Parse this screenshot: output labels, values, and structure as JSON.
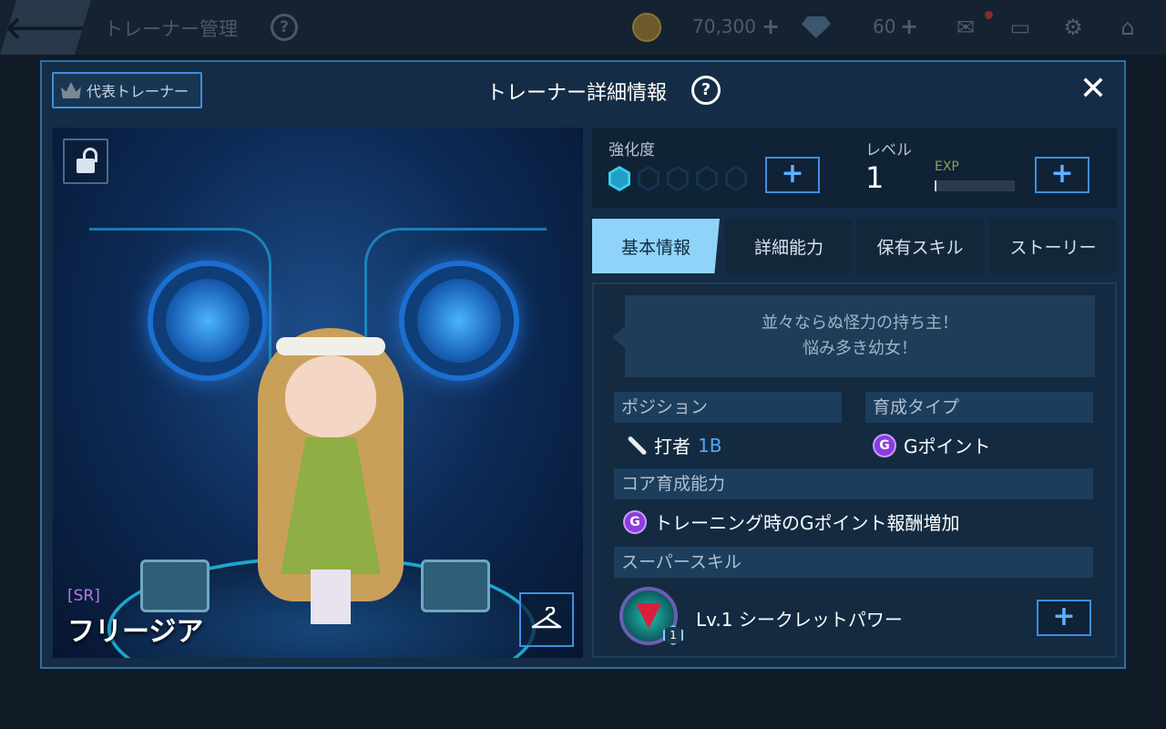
{
  "topbar": {
    "title": "トレーナー管理",
    "help_label": "?",
    "coins": "70,300",
    "gems": "60",
    "plus_label": "+"
  },
  "modal": {
    "representative_button": "代表トレーナー",
    "title": "トレーナー詳細情報",
    "help_label": "?",
    "close_label": "✕"
  },
  "character": {
    "rarity": "[SR]",
    "name": "フリージア"
  },
  "stats": {
    "enhancement_label": "強化度",
    "enhancement_filled": 1,
    "enhancement_total": 5,
    "level_label": "レベル",
    "level_value": "1",
    "exp_label": "EXP",
    "exp_fraction": 0.02,
    "plus_label": "+"
  },
  "tabs": [
    {
      "label": "基本情報",
      "active": true
    },
    {
      "label": "詳細能力",
      "active": false
    },
    {
      "label": "保有スキル",
      "active": false
    },
    {
      "label": "ストーリー",
      "active": false
    }
  ],
  "info": {
    "description_line1": "並々ならぬ怪力の持ち主！",
    "description_line2": "悩み多き幼女！",
    "position_header": "ポジション",
    "position_value": "打者",
    "position_detail": "1B",
    "growth_header": "育成タイプ",
    "growth_icon": "G",
    "growth_value": "Gポイント",
    "core_header": "コア育成能力",
    "core_icon": "G",
    "core_value": "トレーニング時のGポイント報酬増加",
    "super_skill_header": "スーパースキル",
    "skill_level_badge": "1",
    "skill_value": "Lv.1 シークレットパワー",
    "plus_label": "+"
  },
  "colors": {
    "accent": "#3e8fe0",
    "active_tab": "#8fd4f8",
    "rarity": "#b876e6",
    "position_accent": "#4ea8ff",
    "g_icon": "#8a3ee0"
  }
}
